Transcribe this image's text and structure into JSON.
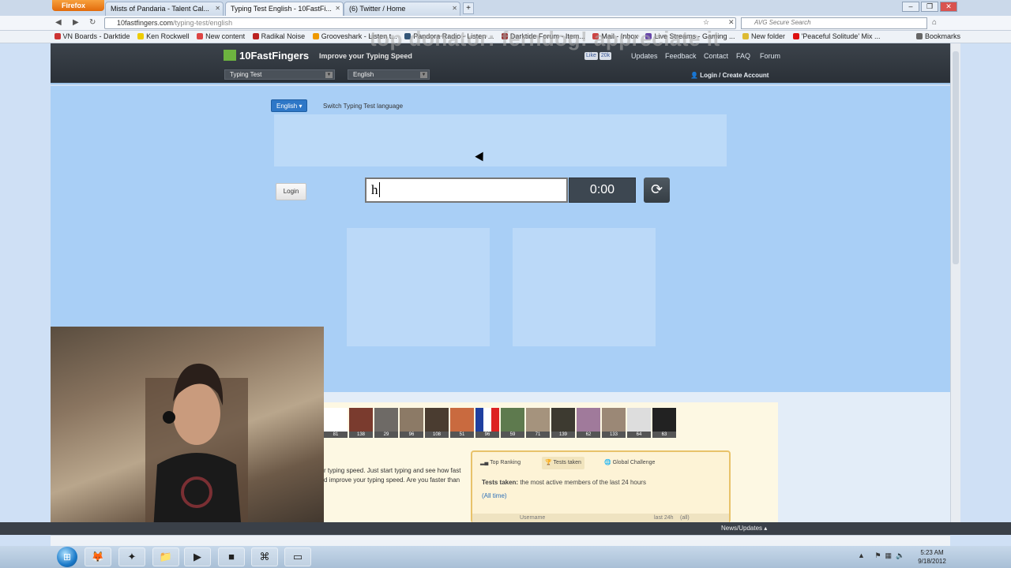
{
  "browser": {
    "firefox_label": "Firefox",
    "tabs": [
      {
        "label": "Mists of Pandaria - Talent Cal...",
        "active": false
      },
      {
        "label": "Typing Test English - 10FastFi...",
        "active": true
      },
      {
        "label": "(6) Twitter / Home",
        "active": false
      }
    ],
    "new_tab": "+",
    "url_host": "10fastfingers.com",
    "url_path": "/typing-test/english",
    "search_placeholder": "AVG Secure Search",
    "bookmarks": [
      "VN Boards - Darktide",
      "Ken Rockwell",
      "New content",
      "Radikal Noise",
      "Grooveshark - Listen t...",
      "Pandora Radio - Listen ...",
      "Darktide Forum - Item...",
      "Mail - Inbox",
      "Live Streams - Gaming ...",
      "New folder",
      "'Peaceful Solitude' Mix ..."
    ],
    "bookmarks_menu": "Bookmarks"
  },
  "overlay_text": "top donator: ferndog! appreciate it",
  "site": {
    "logo": "10FastFingers",
    "tagline": "Improve your Typing Speed",
    "social": [
      "Like",
      "20k"
    ],
    "nav": [
      "Updates",
      "Feedback",
      "Contact",
      "FAQ",
      "Forum"
    ],
    "select_test": "Typing Test",
    "select_language": "English",
    "login_link": "Login / Create Account"
  },
  "test": {
    "language_button": "English",
    "switch_language": "Switch Typing Test language",
    "login_button": "Login",
    "input_value": "h",
    "timer": "0:00"
  },
  "lower": {
    "avatar_scores": [
      "81",
      "138",
      "29",
      "96",
      "108",
      "51",
      "96",
      "59",
      "71",
      "139",
      "62",
      "133",
      "64",
      "63"
    ],
    "intro_line1": "r typing speed. Just start typing and see how fast",
    "intro_line2": "d improve your typing speed. Are you faster than",
    "ranking_tabs": [
      "Top Ranking",
      "Tests taken",
      "Global Challenge"
    ],
    "active_tab": "Tests taken",
    "tests_taken_label": "Tests taken:",
    "tests_taken_desc": "the most active members of the last 24 hours",
    "all_time": "(All time)",
    "col_username": "Username",
    "col_last24": "last 24h",
    "col_all": "(all)"
  },
  "statusbar": {
    "news": "News/Updates"
  },
  "taskbar": {
    "time": "5:23 AM",
    "date": "9/18/2012"
  }
}
